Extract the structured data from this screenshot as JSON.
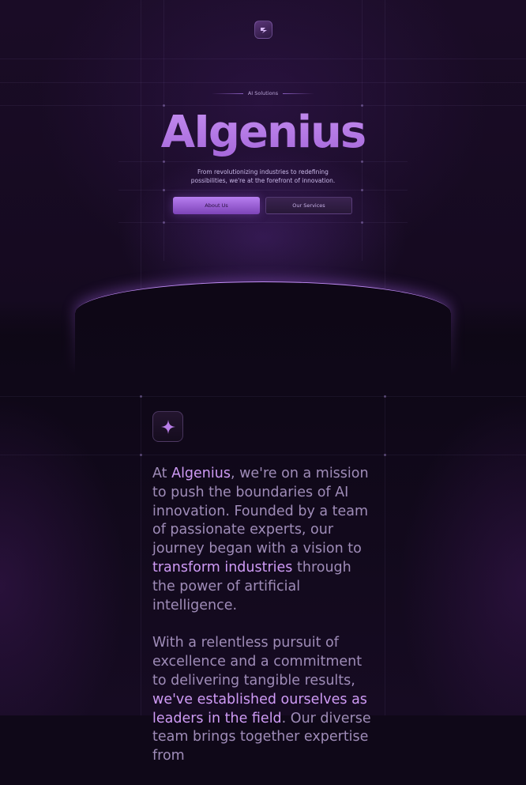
{
  "brand": {
    "eyebrow": "AI Solutions",
    "title": "AIgenius",
    "subtitle": "From revolutionizing industries to redefining possibilities, we're at the forefront of innovation."
  },
  "buttons": {
    "about": "About Us",
    "services": "Our Services"
  },
  "icons": {
    "logo": "logo-mark-icon",
    "feature": "sparkle-icon"
  },
  "about": {
    "p1": {
      "t1": "At ",
      "h1": "Algenius",
      "t2": ", we're on a mission to push the boundaries of AI innovation. Founded by a team of passionate experts, our journey began with a vision to ",
      "h2": "transform industries",
      "t3": " through the power of artificial intelligence."
    },
    "p2": {
      "t1": "With a relentless pursuit of excellence and a commitment to delivering tangible results, ",
      "h1": "we've established ourselves as leaders in the field",
      "t2": ". Our diverse team brings together expertise from"
    }
  },
  "colors": {
    "background": "#0f0818",
    "accent": "#b576e6",
    "highlight": "#cf9bf6"
  }
}
